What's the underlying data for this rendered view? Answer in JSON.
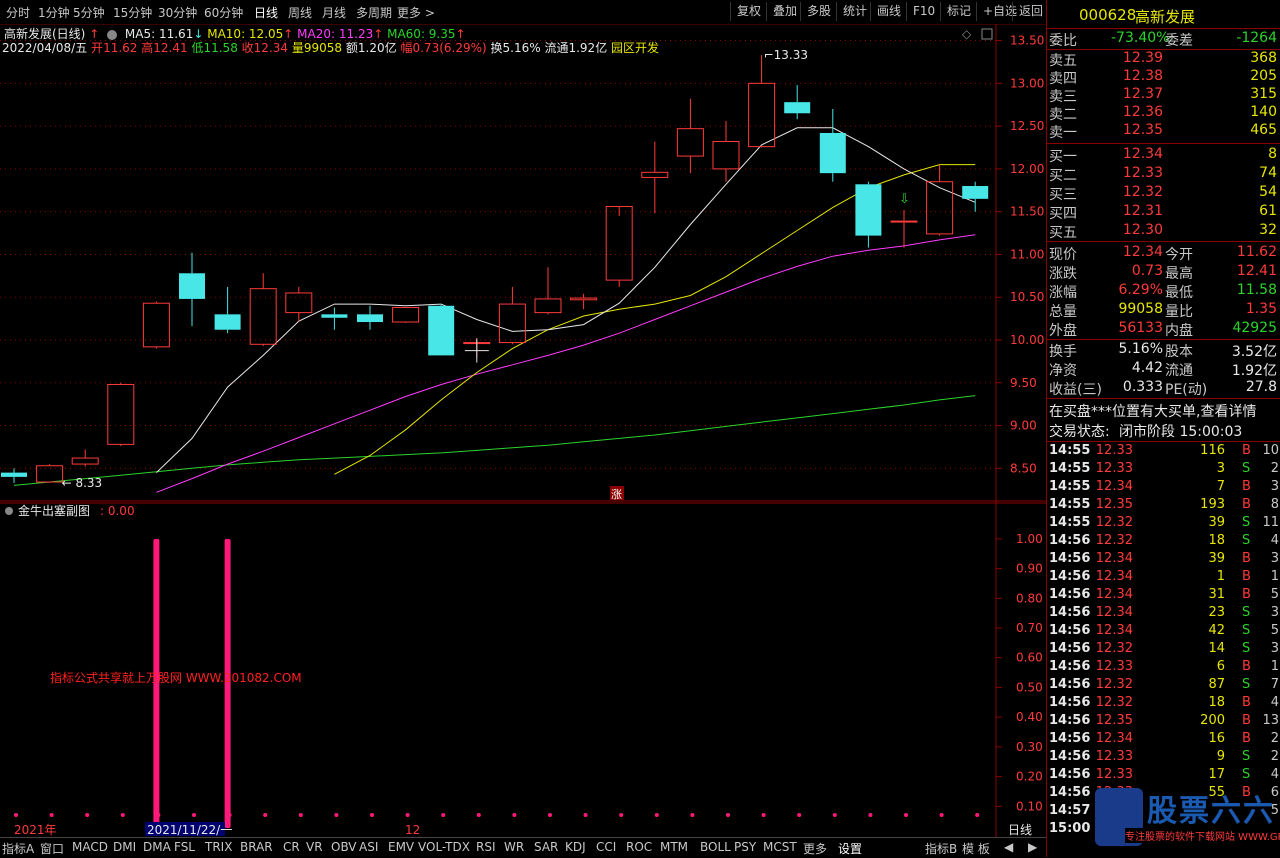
{
  "toolbar": {
    "periods": [
      "分时",
      "1分钟",
      "5分钟",
      "15分钟",
      "30分钟",
      "60分钟",
      "日线",
      "周线",
      "月线",
      "多周期",
      "更多 >"
    ],
    "active_period": "日线",
    "right_buttons": [
      "复权",
      "叠加",
      "多股",
      "统计",
      "画线",
      "F10",
      "标记",
      "+自选",
      "返回"
    ]
  },
  "chart_header": {
    "name": "高新发展(日线)",
    "ma5": "MA5: 11.61",
    "ma10": "MA10: 12.05",
    "ma20": "MA20: 11.23",
    "ma60": "MA60: 9.35"
  },
  "info_line": {
    "date": "2022/04/08/五",
    "open_label": "开",
    "open": "11.62",
    "high_label": "高",
    "high": "12.41",
    "low_label": "低",
    "low": "11.58",
    "close_label": "收",
    "close": "12.34",
    "vol_label": "量",
    "vol": "99058",
    "amt_label": "额",
    "amt": "1.20亿",
    "chg_label": "幅",
    "chg": "0.73(6.29%)",
    "turnover": "换5.16%",
    "float": "流通1.92亿",
    "sector": "园区开发"
  },
  "chart_data": [
    {
      "type": "candlestick",
      "title": "高新发展(日线)",
      "ylim": [
        8.2,
        13.6
      ],
      "yticks": [
        "13.50",
        "13.00",
        "12.50",
        "12.00",
        "11.50",
        "11.00",
        "10.50",
        "10.00",
        "9.50",
        "9.00",
        "8.50"
      ],
      "candles": [
        {
          "o": 8.45,
          "h": 8.5,
          "l": 8.33,
          "c": 8.4
        },
        {
          "o": 8.34,
          "h": 8.55,
          "l": 8.33,
          "c": 8.53
        },
        {
          "o": 8.55,
          "h": 8.72,
          "l": 8.52,
          "c": 8.62
        },
        {
          "o": 8.78,
          "h": 9.5,
          "l": 8.76,
          "c": 9.48
        },
        {
          "o": 9.92,
          "h": 10.45,
          "l": 9.9,
          "c": 10.43
        },
        {
          "o": 10.78,
          "h": 11.02,
          "l": 10.16,
          "c": 10.48
        },
        {
          "o": 10.3,
          "h": 10.62,
          "l": 10.08,
          "c": 10.12
        },
        {
          "o": 9.95,
          "h": 10.78,
          "l": 9.93,
          "c": 10.6
        },
        {
          "o": 10.32,
          "h": 10.62,
          "l": 10.22,
          "c": 10.55
        },
        {
          "o": 10.3,
          "h": 10.38,
          "l": 10.12,
          "c": 10.26
        },
        {
          "o": 10.3,
          "h": 10.4,
          "l": 10.12,
          "c": 10.21
        },
        {
          "o": 10.21,
          "h": 10.38,
          "l": 10.2,
          "c": 10.38
        },
        {
          "o": 10.4,
          "h": 10.42,
          "l": 9.85,
          "c": 9.82
        },
        {
          "o": 9.97,
          "h": 10.02,
          "l": 9.8,
          "c": 9.97
        },
        {
          "o": 9.97,
          "h": 10.62,
          "l": 9.95,
          "c": 10.42
        },
        {
          "o": 10.32,
          "h": 10.85,
          "l": 10.3,
          "c": 10.48
        },
        {
          "o": 10.47,
          "h": 10.54,
          "l": 10.36,
          "c": 10.49
        },
        {
          "o": 10.7,
          "h": 11.45,
          "l": 10.62,
          "c": 11.56
        },
        {
          "o": 11.9,
          "h": 12.32,
          "l": 11.48,
          "c": 11.96
        },
        {
          "o": 12.15,
          "h": 12.82,
          "l": 11.95,
          "c": 12.47
        },
        {
          "o": 12.0,
          "h": 12.56,
          "l": 11.85,
          "c": 12.32
        },
        {
          "o": 12.26,
          "h": 13.33,
          "l": 12.25,
          "c": 13.0
        },
        {
          "o": 12.78,
          "h": 12.98,
          "l": 12.58,
          "c": 12.65
        },
        {
          "o": 12.42,
          "h": 12.7,
          "l": 11.85,
          "c": 11.95
        },
        {
          "o": 11.82,
          "h": 11.85,
          "l": 11.08,
          "c": 11.22
        },
        {
          "o": 11.39,
          "h": 11.52,
          "l": 11.08,
          "c": 11.39
        },
        {
          "o": 11.24,
          "h": 12.05,
          "l": 11.22,
          "c": 11.85
        },
        {
          "o": 11.8,
          "h": 11.85,
          "l": 11.5,
          "c": 11.65
        }
      ],
      "ma5": [
        null,
        null,
        null,
        null,
        8.45,
        8.85,
        9.45,
        9.82,
        10.22,
        10.42,
        10.42,
        10.4,
        10.42,
        10.24,
        10.1,
        10.12,
        10.18,
        10.43,
        10.85,
        11.35,
        11.82,
        12.28,
        12.48,
        12.48,
        12.26,
        12.0,
        11.78,
        11.61
      ],
      "ma10": [
        null,
        null,
        null,
        null,
        null,
        null,
        null,
        null,
        null,
        8.43,
        8.65,
        8.95,
        9.3,
        9.62,
        9.9,
        10.12,
        10.28,
        10.36,
        10.42,
        10.52,
        10.74,
        11.01,
        11.28,
        11.55,
        11.78,
        11.93,
        12.05,
        12.05
      ],
      "ma20": [
        null,
        null,
        null,
        null,
        8.22,
        8.38,
        8.55,
        8.7,
        8.86,
        9.02,
        9.18,
        9.34,
        9.48,
        9.6,
        9.71,
        9.82,
        9.94,
        10.08,
        10.24,
        10.4,
        10.56,
        10.72,
        10.86,
        10.98,
        11.05,
        11.1,
        11.17,
        11.23
      ],
      "ma60": [
        8.3,
        8.34,
        8.38,
        8.42,
        8.46,
        8.5,
        8.54,
        8.57,
        8.6,
        8.62,
        8.64,
        8.66,
        8.68,
        8.71,
        8.74,
        8.77,
        8.81,
        8.85,
        8.89,
        8.94,
        8.99,
        9.04,
        9.09,
        9.14,
        9.19,
        9.24,
        9.3,
        9.35
      ],
      "annotations": [
        {
          "text": "13.33",
          "index": 21,
          "value": 13.33
        },
        {
          "text": "8.33",
          "index": 1,
          "value": 8.33
        }
      ]
    },
    {
      "type": "bar",
      "title": "金牛出塞副图",
      "value_label": "0.00",
      "ylim": [
        0,
        1.05
      ],
      "yticks": [
        "1.00",
        "0.90",
        "0.80",
        "0.70",
        "0.60",
        "0.50",
        "0.40",
        "0.30",
        "0.20",
        "0.10"
      ],
      "values": [
        0,
        0,
        0,
        0,
        1,
        0,
        1,
        0,
        0,
        0,
        0,
        0,
        0,
        0,
        0,
        0,
        0,
        0,
        0,
        0,
        0,
        0,
        0,
        0,
        0,
        0,
        0,
        0
      ],
      "watermark": "指标公式共享就上万股网 WWW.201082.COM"
    }
  ],
  "main_labels": {
    "zhang": "涨"
  },
  "xaxis": {
    "left": "2021年",
    "cursor_date": "2021/11/22/一",
    "mid": "12",
    "period": "日线"
  },
  "bottom_tabs": [
    "指标A",
    "窗口",
    "MACD",
    "DMI",
    "DMA",
    "FSL",
    "TRIX",
    "BRAR",
    "CR",
    "VR",
    "OBV",
    "ASI",
    "EMV",
    "VOL-TDX",
    "RSI",
    "WR",
    "SAR",
    "KDJ",
    "CCI",
    "ROC",
    "MTM",
    "BOLL",
    "PSY",
    "MCST",
    "更多",
    "设置"
  ],
  "bottom_right": [
    "指标B",
    "模 板",
    "◀",
    "▶"
  ],
  "quote": {
    "code": "000628",
    "name": "高新发展",
    "weibi_label": "委比",
    "weibi": "-73.40%",
    "weicha_label": "委差",
    "weicha": "-1264",
    "asks": [
      {
        "label": "卖五",
        "price": "12.39",
        "vol": "368"
      },
      {
        "label": "卖四",
        "price": "12.38",
        "vol": "205"
      },
      {
        "label": "卖三",
        "price": "12.37",
        "vol": "315"
      },
      {
        "label": "卖二",
        "price": "12.36",
        "vol": "140"
      },
      {
        "label": "卖一",
        "price": "12.35",
        "vol": "465"
      }
    ],
    "bids": [
      {
        "label": "买一",
        "price": "12.34",
        "vol": "8"
      },
      {
        "label": "买二",
        "price": "12.33",
        "vol": "74"
      },
      {
        "label": "买三",
        "price": "12.32",
        "vol": "54"
      },
      {
        "label": "买四",
        "price": "12.31",
        "vol": "61"
      },
      {
        "label": "买五",
        "price": "12.30",
        "vol": "32"
      }
    ],
    "stats1": [
      {
        "l1": "现价",
        "v1": "12.34",
        "c1": "red",
        "l2": "今开",
        "v2": "11.62",
        "c2": "red"
      },
      {
        "l1": "涨跌",
        "v1": "0.73",
        "c1": "red",
        "l2": "最高",
        "v2": "12.41",
        "c2": "red"
      },
      {
        "l1": "涨幅",
        "v1": "6.29%",
        "c1": "red",
        "l2": "最低",
        "v2": "11.58",
        "c2": "green"
      },
      {
        "l1": "总量",
        "v1": "99058",
        "c1": "yellow",
        "l2": "量比",
        "v2": "1.35",
        "c2": "red"
      },
      {
        "l1": "外盘",
        "v1": "56133",
        "c1": "red",
        "l2": "内盘",
        "v2": "42925",
        "c2": "green"
      }
    ],
    "stats2": [
      {
        "l1": "换手",
        "v1": "5.16%",
        "l2": "股本",
        "v2": "3.52亿"
      },
      {
        "l1": "净资",
        "v1": "4.42",
        "l2": "流通",
        "v2": "1.92亿"
      },
      {
        "l1": "收益(三)",
        "v1": "0.333",
        "l2": "PE(动)",
        "v2": "27.8"
      }
    ],
    "notice": "在买盘***位置有大买单,查看详情",
    "status_label": "交易状态:",
    "status": "闭市阶段 15:00:03"
  },
  "ticks": [
    {
      "t": "14:55",
      "p": "12.33",
      "v": "116",
      "s": "B",
      "n": "10"
    },
    {
      "t": "14:55",
      "p": "12.33",
      "v": "3",
      "s": "S",
      "n": "2"
    },
    {
      "t": "14:55",
      "p": "12.34",
      "v": "7",
      "s": "B",
      "n": "3"
    },
    {
      "t": "14:55",
      "p": "12.35",
      "v": "193",
      "s": "B",
      "n": "8"
    },
    {
      "t": "14:55",
      "p": "12.32",
      "v": "39",
      "s": "S",
      "n": "11"
    },
    {
      "t": "14:56",
      "p": "12.32",
      "v": "18",
      "s": "S",
      "n": "4"
    },
    {
      "t": "14:56",
      "p": "12.34",
      "v": "39",
      "s": "B",
      "n": "3"
    },
    {
      "t": "14:56",
      "p": "12.34",
      "v": "1",
      "s": "B",
      "n": "1"
    },
    {
      "t": "14:56",
      "p": "12.34",
      "v": "31",
      "s": "B",
      "n": "5"
    },
    {
      "t": "14:56",
      "p": "12.34",
      "v": "23",
      "s": "S",
      "n": "3"
    },
    {
      "t": "14:56",
      "p": "12.34",
      "v": "42",
      "s": "S",
      "n": "5"
    },
    {
      "t": "14:56",
      "p": "12.32",
      "v": "14",
      "s": "S",
      "n": "3"
    },
    {
      "t": "14:56",
      "p": "12.33",
      "v": "6",
      "s": "B",
      "n": "1"
    },
    {
      "t": "14:56",
      "p": "12.32",
      "v": "87",
      "s": "S",
      "n": "7"
    },
    {
      "t": "14:56",
      "p": "12.32",
      "v": "18",
      "s": "B",
      "n": "4"
    },
    {
      "t": "14:56",
      "p": "12.35",
      "v": "200",
      "s": "B",
      "n": "13"
    },
    {
      "t": "14:56",
      "p": "12.34",
      "v": "16",
      "s": "B",
      "n": "2"
    },
    {
      "t": "14:56",
      "p": "12.33",
      "v": "9",
      "s": "S",
      "n": "2"
    },
    {
      "t": "14:56",
      "p": "12.33",
      "v": "17",
      "s": "S",
      "n": "4"
    },
    {
      "t": "14:56",
      "p": "12.33",
      "v": "55",
      "s": "B",
      "n": "6"
    },
    {
      "t": "14:57",
      "p": "12.33",
      "v": "",
      "s": "",
      "n": "5"
    },
    {
      "t": "15:00",
      "p": "",
      "v": "",
      "s": "",
      "n": ""
    }
  ],
  "logo": {
    "big": "股票六六",
    "small": "专注股票的软件下载网站 WWW.GP66.CN"
  },
  "colors": {
    "up": "#ff3a3a",
    "down": "#48e6e6",
    "ma5": "#e8e8e8",
    "ma10": "#e6e600",
    "ma20": "#ff3cff",
    "ma60": "#2bd32b",
    "grid": "#8b0000",
    "indicator": "#ff1a7a"
  }
}
